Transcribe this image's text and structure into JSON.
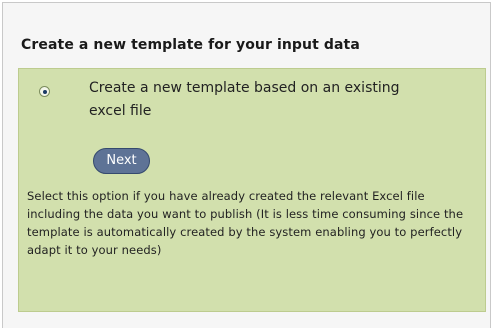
{
  "panel": {
    "heading": "Create a new template for your input data",
    "option": {
      "label": "Create a new template based on an existing excel file",
      "selected": true,
      "next_label": "Next",
      "description": "Select this option if you have already created the relevant Excel file including the data you want to publish (It is less time consuming since the template is automatically created by the system enabling you to perfectly adapt it to your needs)"
    }
  },
  "colors": {
    "option_background": "#d2e0ad",
    "button_background": "#5e7396",
    "panel_background": "#f6f6f6"
  }
}
